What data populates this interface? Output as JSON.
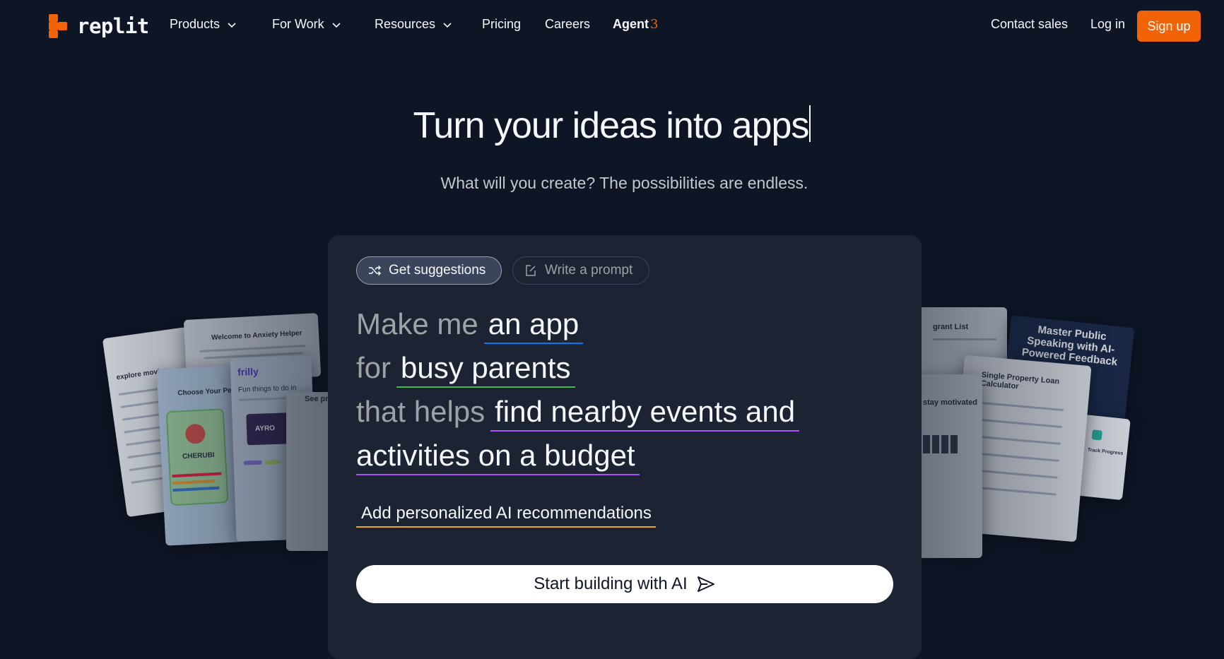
{
  "nav": {
    "logo_text": "replit",
    "items": [
      {
        "label": "Products",
        "dropdown": true
      },
      {
        "label": "For Work",
        "dropdown": true
      },
      {
        "label": "Resources",
        "dropdown": true
      },
      {
        "label": "Pricing"
      },
      {
        "label": "Careers"
      },
      {
        "label": "Agent",
        "badge": "3"
      }
    ],
    "contact_sales": "Contact sales",
    "log_in": "Log in",
    "sign_up": "Sign up"
  },
  "hero": {
    "title": "Turn your ideas into apps",
    "subtitle": "What will you create? The possibilities are endless."
  },
  "builder": {
    "tabs": [
      {
        "label": "Get suggestions",
        "icon": "shuffle-icon",
        "active": true
      },
      {
        "label": "Write a prompt",
        "icon": "edit-icon",
        "active": false
      }
    ],
    "prompt": {
      "lead": "Make me",
      "app_type": "an app",
      "for_word": "for",
      "audience": "busy parents",
      "helps_word": "that helps",
      "goal_line1": "find nearby events and",
      "goal_line2": "activities on a budget"
    },
    "extra_feature": "Add personalized AI recommendations",
    "cta_label": "Start building with AI"
  },
  "preview_cards": {
    "left": [
      {
        "title": "Welcome to Anxiety Helper"
      },
      {
        "title": "explore movies"
      },
      {
        "title": "Choose Your Pet"
      },
      {
        "title": "CHERUBI"
      },
      {
        "title": "frilly"
      },
      {
        "title": "Fun things to do in"
      },
      {
        "title": "AYRO"
      },
      {
        "title": "See pr"
      }
    ],
    "right": [
      {
        "title": "Master Public Speaking with AI-Powered Feedback"
      },
      {
        "title": "Single Property Loan Calculator"
      },
      {
        "title": "stay motivated"
      },
      {
        "title": "grant List"
      },
      {
        "title": "Track Progress"
      }
    ]
  },
  "colors": {
    "background": "#0e1525",
    "panel": "#1c2333",
    "accent": "#f26207",
    "blue_underline": "#0079f2",
    "green_underline": "#3fb950",
    "purple_underline": "#a855f7",
    "yellow_underline": "#e8a91e"
  }
}
